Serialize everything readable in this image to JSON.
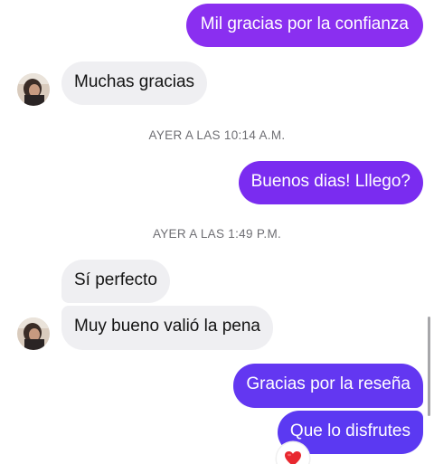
{
  "conversation": {
    "messages": [
      {
        "id": "m1",
        "direction": "outgoing",
        "text": "Mil gracias por la confianza"
      },
      {
        "id": "m2",
        "direction": "incoming",
        "text": "Muchas gracias"
      },
      {
        "id": "m3",
        "direction": "outgoing",
        "text": "Buenos dias! Lllego?"
      },
      {
        "id": "m4",
        "direction": "incoming",
        "text": "Sí perfecto"
      },
      {
        "id": "m5",
        "direction": "incoming",
        "text": "Muy bueno valió la pena"
      },
      {
        "id": "m6",
        "direction": "outgoing",
        "text": "Gracias por la reseña"
      },
      {
        "id": "m7",
        "direction": "outgoing",
        "text": "Que lo disfrutes",
        "reaction": "heart-icon"
      }
    ],
    "timestamps": [
      "AYER A LAS 10:14 A.M.",
      "AYER A LAS 1:49 P.M."
    ]
  },
  "colors": {
    "outgoing_top": "#8a2ff0",
    "outgoing_mid": "#7a2cf0",
    "outgoing_bottom": "#5b39f2",
    "incoming_bg": "#efeff2",
    "reaction_heart": "#e8282f"
  }
}
